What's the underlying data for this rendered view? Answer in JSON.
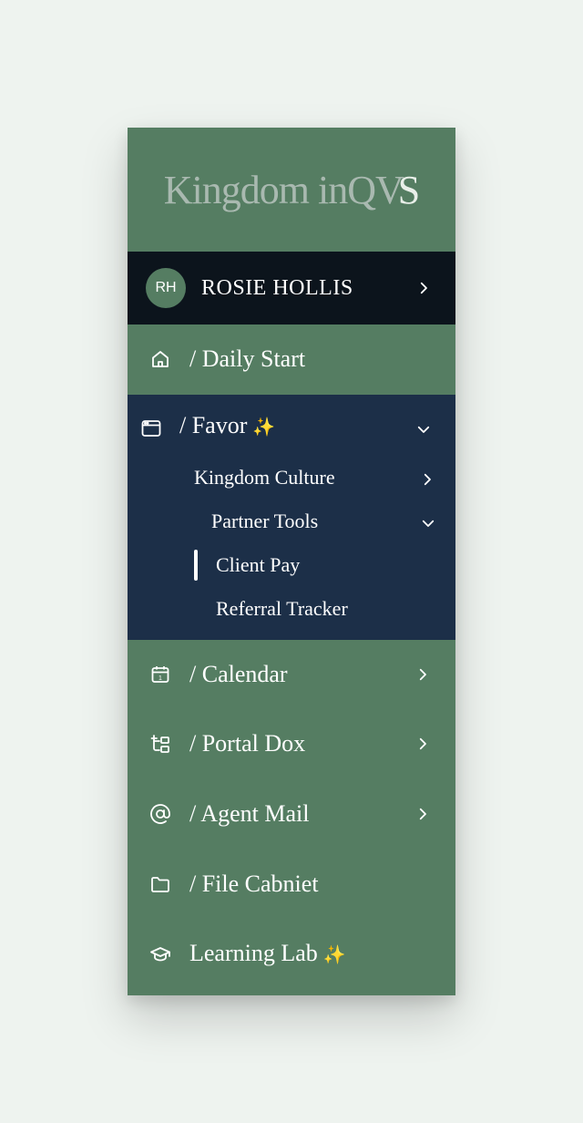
{
  "logo": {
    "main": "Kingdom inQV",
    "last": "S"
  },
  "user": {
    "initials": "RH",
    "name": "ROSIE HOLLIS"
  },
  "nav": {
    "daily_start": "/ Daily Start",
    "favor": {
      "label": "/ Favor",
      "sparkle": "✨"
    },
    "kingdom_culture": "Kingdom Culture",
    "partner_tools": "Partner Tools",
    "client_pay": "Client Pay",
    "referral_tracker": "Referral Tracker",
    "calendar": "/ Calendar",
    "calendar_day": "1",
    "portal_dox": "/ Portal Dox",
    "agent_mail": "/ Agent Mail",
    "file_cabinet": "/ File Cabniet",
    "learning_lab": {
      "label": "Learning Lab",
      "sparkle": "✨"
    }
  },
  "colors": {
    "sidebar_bg": "#557d62",
    "user_bg": "#0c141c",
    "expanded_bg": "#1c2f48",
    "page_bg": "#eef3ef"
  }
}
